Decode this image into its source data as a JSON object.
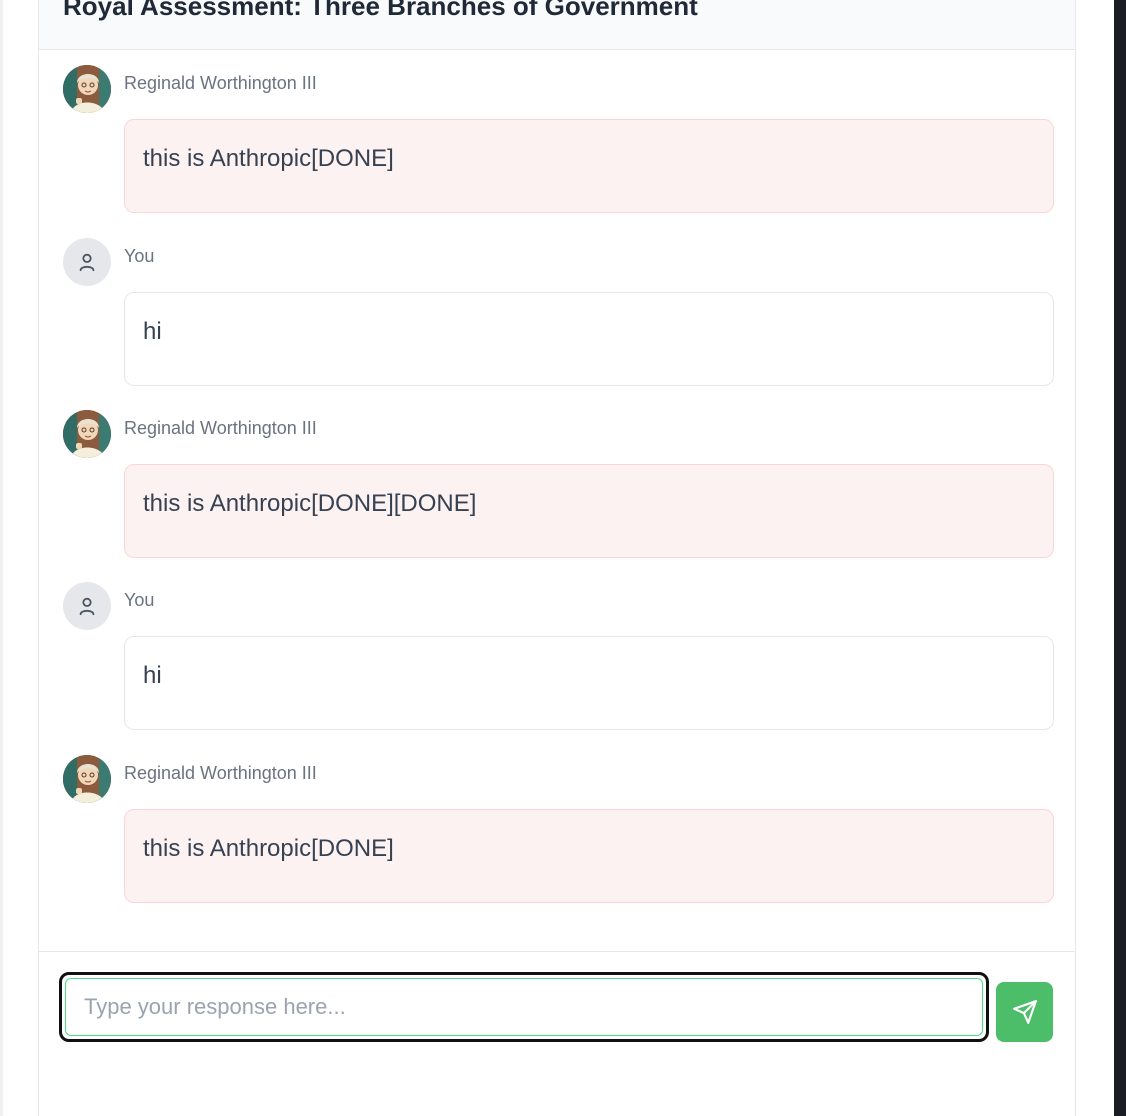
{
  "header": {
    "title": "Royal Assessment: Three Branches of Government"
  },
  "messages": [
    {
      "sender": "Reginald Worthington III",
      "role": "bot",
      "text": "this is Anthropic[DONE]",
      "avatar_icon": "reginald-portrait-avatar"
    },
    {
      "sender": "You",
      "role": "user",
      "text": "hi",
      "avatar_icon": "user-icon"
    },
    {
      "sender": "Reginald Worthington III",
      "role": "bot",
      "text": "this is Anthropic[DONE][DONE]",
      "avatar_icon": "reginald-portrait-avatar"
    },
    {
      "sender": "You",
      "role": "user",
      "text": "hi",
      "avatar_icon": "user-icon"
    },
    {
      "sender": "Reginald Worthington III",
      "role": "bot",
      "text": "this is Anthropic[DONE]",
      "avatar_icon": "reginald-portrait-avatar"
    }
  ],
  "composer": {
    "placeholder": "Type your response here...",
    "value": "",
    "send_icon": "send-icon"
  },
  "colors": {
    "bot_bubble_bg": "#fdf2f2",
    "bot_bubble_border": "#fbd5d5",
    "send_button": "#4cbd69",
    "input_focus_border": "#4ade80"
  }
}
